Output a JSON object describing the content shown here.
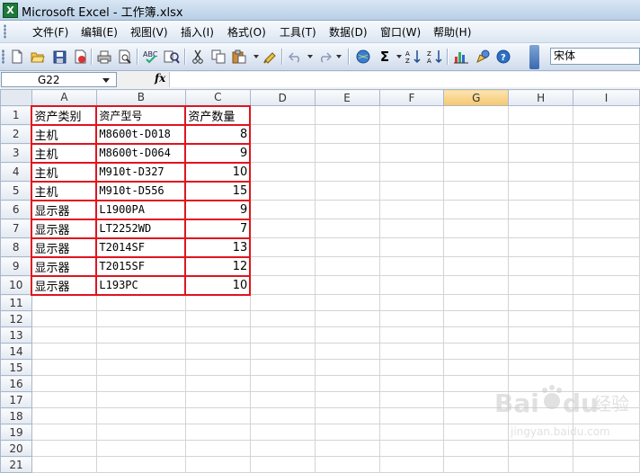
{
  "window": {
    "title": "Microsoft Excel - 工作簿.xlsx",
    "app_icon_letter": "X"
  },
  "menu": [
    {
      "label": "文件(F)"
    },
    {
      "label": "编辑(E)"
    },
    {
      "label": "视图(V)"
    },
    {
      "label": "插入(I)"
    },
    {
      "label": "格式(O)"
    },
    {
      "label": "工具(T)"
    },
    {
      "label": "数据(D)"
    },
    {
      "label": "窗口(W)"
    },
    {
      "label": "帮助(H)"
    }
  ],
  "toolbar": {
    "icons": [
      "new-icon",
      "open-icon",
      "save-icon",
      "permission-icon",
      "print-icon",
      "print-preview-icon",
      "spelling-icon",
      "research-icon",
      "cut-icon",
      "copy-icon",
      "paste-icon",
      "format-painter-icon",
      "undo-icon",
      "redo-icon",
      "hyperlink-icon",
      "autosum-icon",
      "sort-ascending-icon",
      "sort-descending-icon",
      "chart-wizard-icon",
      "drawing-icon",
      "help-icon"
    ],
    "autosum_glyph": "Σ",
    "font_name": "宋体"
  },
  "formula_bar": {
    "name_box": "G22",
    "fx_label": "fx",
    "formula": ""
  },
  "sheet": {
    "columns": [
      "A",
      "B",
      "C",
      "D",
      "E",
      "F",
      "G",
      "H",
      "I"
    ],
    "active_column": "G",
    "row_numbers": [
      "1",
      "2",
      "3",
      "4",
      "5",
      "6",
      "7",
      "8",
      "9",
      "10",
      "11",
      "12",
      "13",
      "14",
      "15",
      "16",
      "17",
      "18",
      "19",
      "20",
      "21"
    ],
    "rows": [
      [
        "资产类别",
        "资产型号",
        "资产数量"
      ],
      [
        "主机",
        "M8600t-D018",
        "8"
      ],
      [
        "主机",
        "M8600t-D064",
        "9"
      ],
      [
        "主机",
        "M910t-D327",
        "10"
      ],
      [
        "主机",
        "M910t-D556",
        "15"
      ],
      [
        "显示器",
        "L1900PA",
        "9"
      ],
      [
        "显示器",
        "LT2252WD",
        "7"
      ],
      [
        "显示器",
        "T2014SF",
        "13"
      ],
      [
        "显示器",
        "T2015SF",
        "12"
      ],
      [
        "显示器",
        "L193PC",
        "10"
      ]
    ]
  },
  "watermark": {
    "brand": "Bai",
    "brand2": "du",
    "cn": "经验",
    "url": "jingyan.baidu.com"
  },
  "colors": {
    "highlight_border": "#e0141e",
    "active_column_header": "#f6c76c"
  }
}
